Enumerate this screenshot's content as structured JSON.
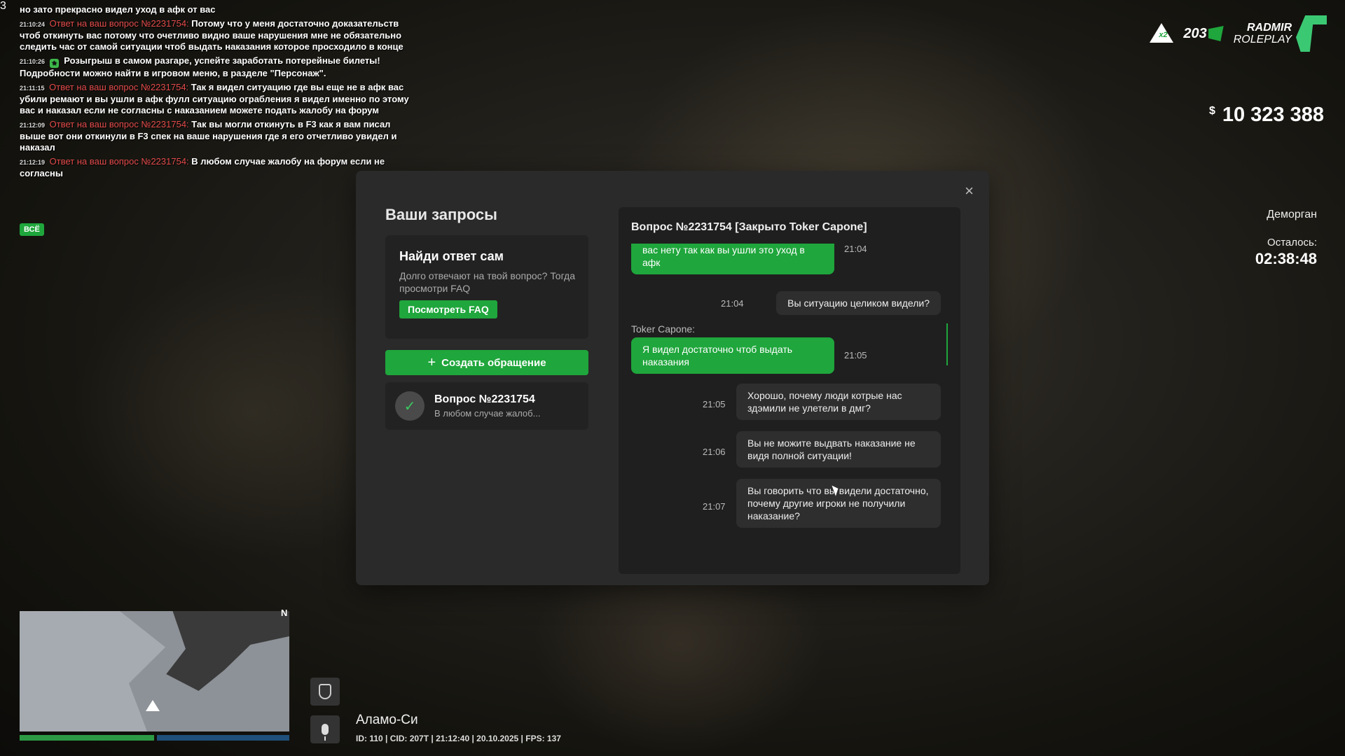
{
  "chat": {
    "lines": [
      {
        "time": "",
        "answer": "",
        "text": "но зато прекрасно видел уход в афк от вас"
      },
      {
        "time": "21:10:24",
        "answer": "Ответ на ваш вопрос №2231754:",
        "text": "Потому что у меня достаточно доказательств чтоб откинуть вас потому что очетливо видно ваше нарушения мне не обязательно следить час от самой ситуации чтоб выдать наказания которое просходило в конце"
      },
      {
        "time": "21:10:26",
        "answer": "",
        "text": "Розыгрыш в самом разгаре, успейте заработать потерейные билеты! Подробности можно найти в игровом меню, в разделе \"Персонаж\"."
      },
      {
        "time": "21:11:15",
        "answer": "Ответ на ваш вопрос №2231754:",
        "text": "Так я видел ситуацию где вы еще не в афк вас убили ремают и вы ушли в афк фулл ситуацию ограбления я видел именно по этому вас и наказал если не согласны с наказанием можете подать жалобу на форум"
      },
      {
        "time": "21:12:09",
        "answer": "Ответ на ваш вопрос №2231754:",
        "text": "Так вы могли откинуть в F3 как я вам писал выше вот они откинули в F3 спек на ваше нарушения где я его отчетливо увидел и наказал"
      },
      {
        "time": "21:12:19",
        "answer": "Ответ на ваш вопрос №2231754:",
        "text": "В любом случае жалобу на форум если не согласны"
      }
    ],
    "filter_badge": "ВСЁ"
  },
  "hud": {
    "x2_label": "x2",
    "online": "203",
    "logo_line1": "RADMIR",
    "logo_line2": "ROLEPLAY",
    "server_number": "3",
    "money_symbol": "$",
    "money": "10 323 388",
    "jail_label": "Деморган",
    "remaining_label": "Осталось:",
    "remaining_time": "02:38:48"
  },
  "modal": {
    "title": "Ваши запросы",
    "close": "×",
    "faq": {
      "heading": "Найди ответ сам",
      "text": "Долго отвечают на твой вопрос? Тогда просмотри FAQ",
      "button": "Посмотреть FAQ"
    },
    "create_button": "Создать обращение",
    "requests": [
      {
        "title": "Вопрос №2231754",
        "preview": "В любом случае жалоб..."
      }
    ],
    "chat_title": "Вопрос №2231754 [Закрыто Toker Capone]",
    "messages": [
      {
        "text": "вас нету так как вы ушли это уход в афк",
        "time": "21:04"
      },
      {
        "text": "Вы ситуацию целиком видели?",
        "time": "21:04"
      },
      {
        "sender": "Toker Capone:",
        "text": "Я видел достаточно чтоб выдать наказания",
        "time": "21:05"
      },
      {
        "text": "Хорошо, почему люди котрые нас здэмили не улетели в дмг?",
        "time": "21:05"
      },
      {
        "text": "Вы не можите выдвать наказание не видя полной ситуации!",
        "time": "21:06"
      },
      {
        "text": "Вы говорить что вы видели достаточно, почему другие игроки не получили наказание?",
        "time": "21:07"
      }
    ]
  },
  "bottom": {
    "compass": "N",
    "location": "Аламо-Си",
    "info": "ID: 110 | CID: 207Т | 21:12:40   | 20.10.2025 | FPS: 137"
  }
}
